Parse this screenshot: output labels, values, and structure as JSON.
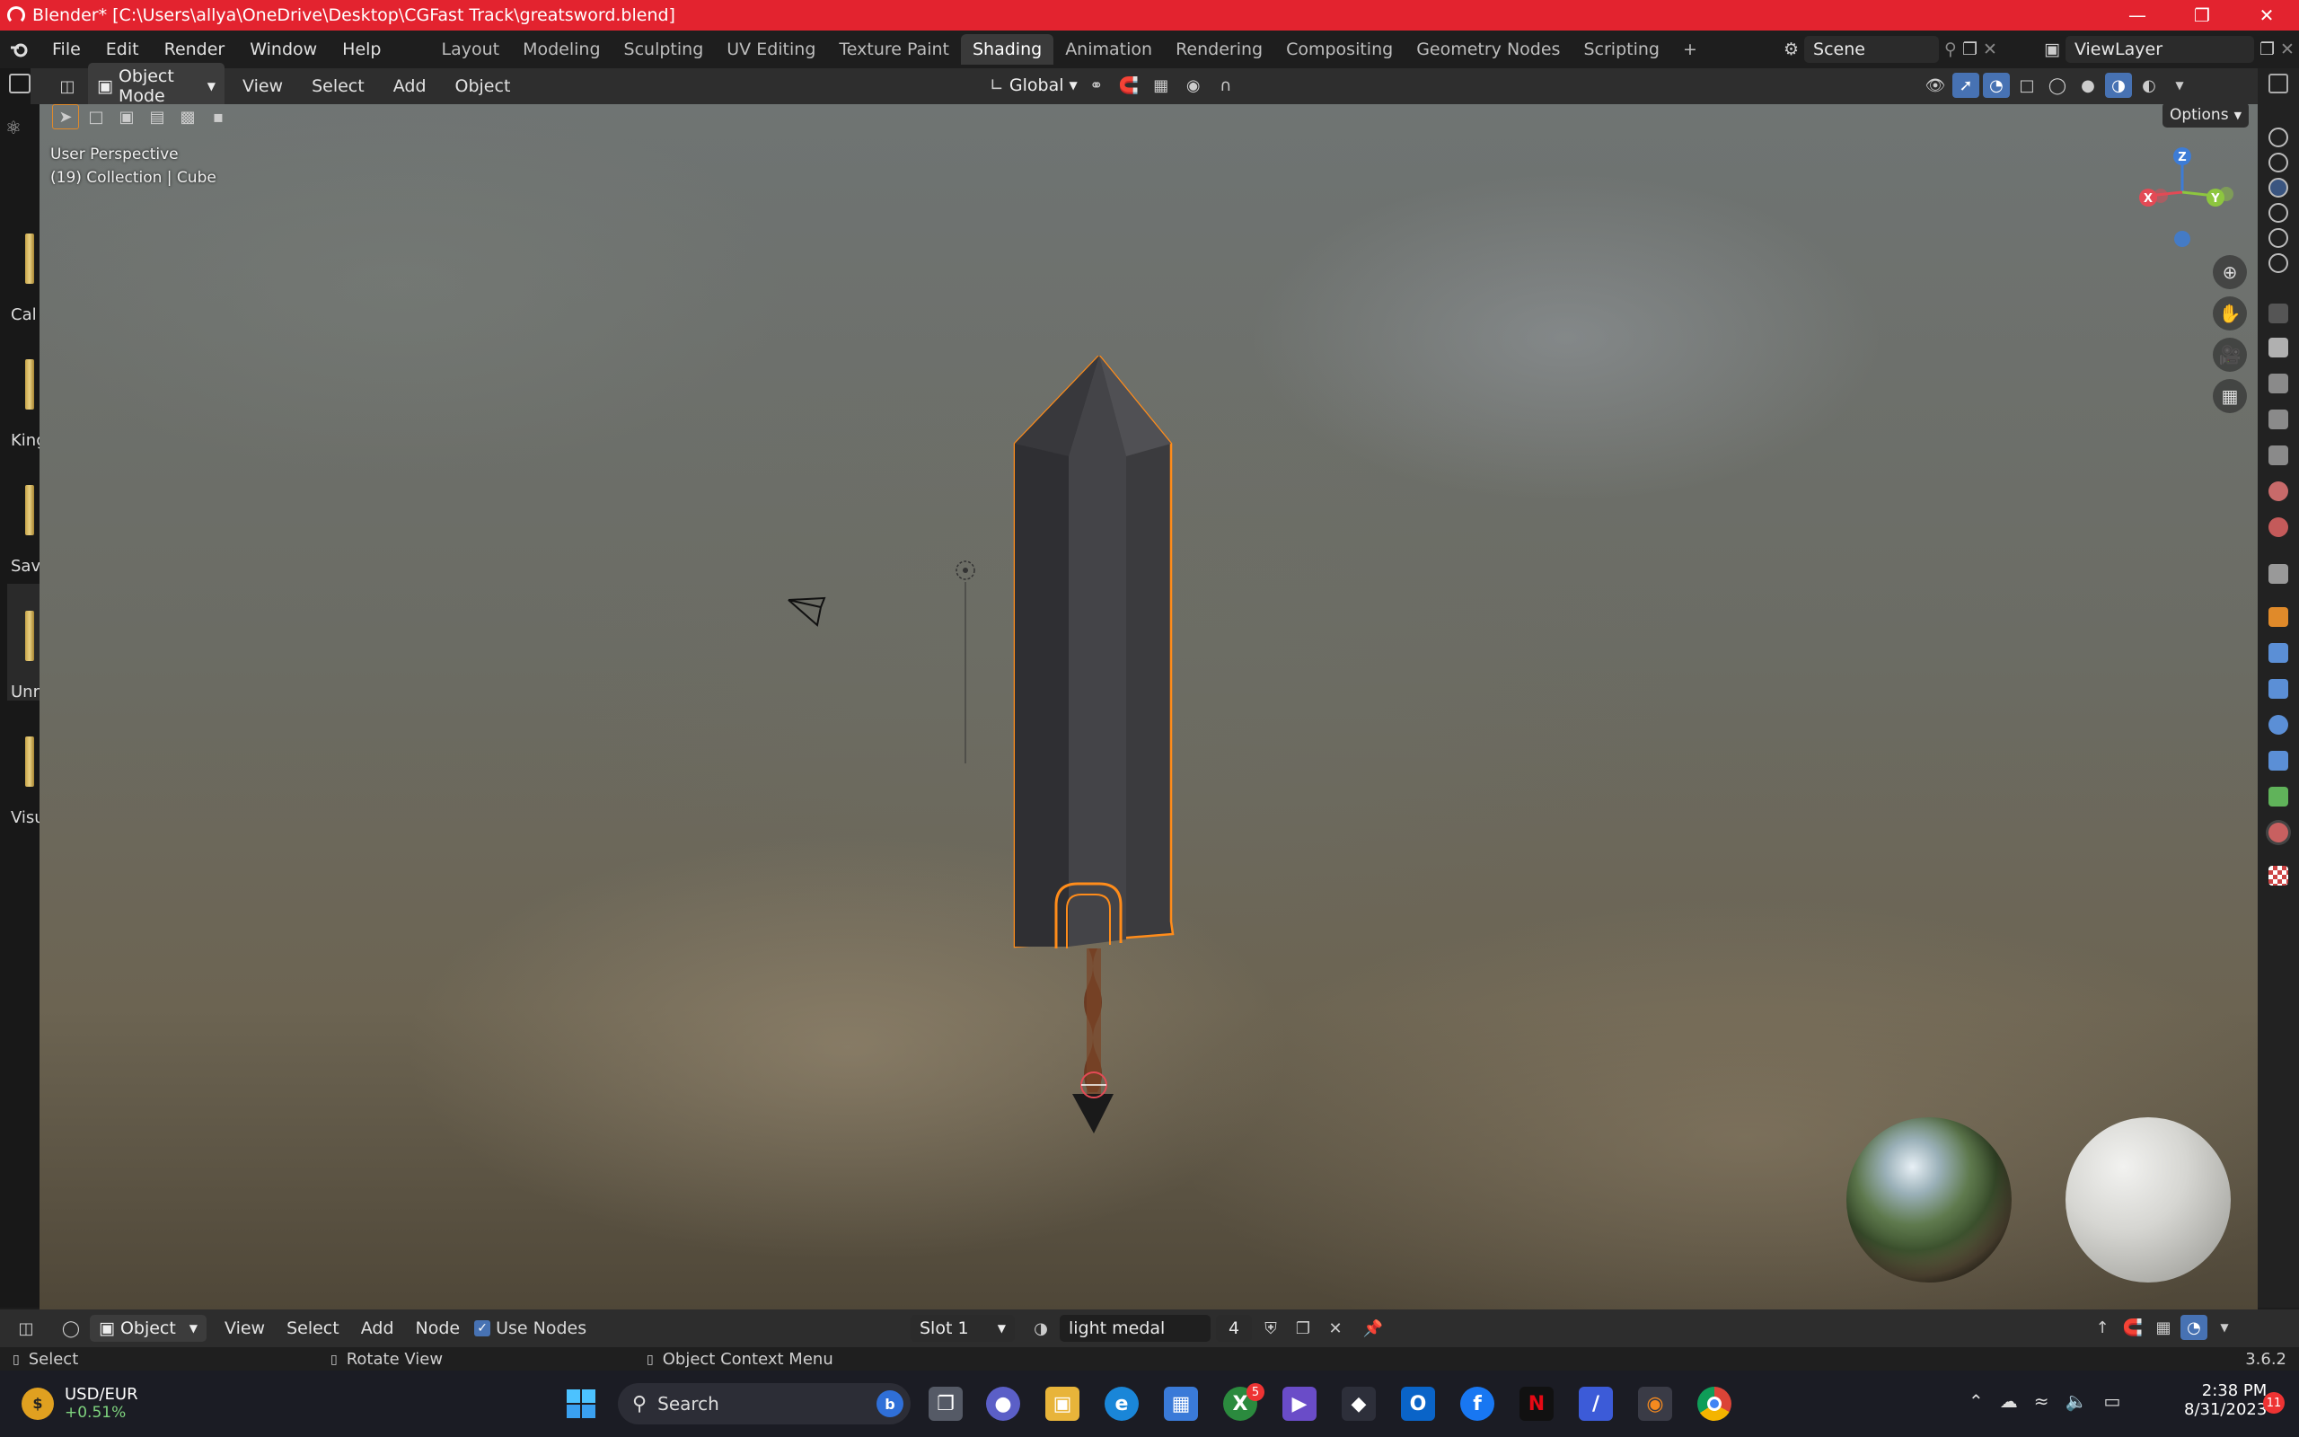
{
  "window": {
    "title": "Blender* [C:\\Users\\allya\\OneDrive\\Desktop\\CGFast Track\\greatsword.blend]"
  },
  "topbar": {
    "menus": [
      "File",
      "Edit",
      "Render",
      "Window",
      "Help"
    ],
    "workspaces": [
      "Layout",
      "Modeling",
      "Sculpting",
      "UV Editing",
      "Texture Paint",
      "Shading",
      "Animation",
      "Rendering",
      "Compositing",
      "Geometry Nodes",
      "Scripting"
    ],
    "active_workspace": "Shading",
    "add_tab": "+",
    "scene_value": "Scene",
    "viewlayer_value": "ViewLayer"
  },
  "viewport_header": {
    "mode": "Object Mode",
    "menus": [
      "View",
      "Select",
      "Add",
      "Object"
    ],
    "orientation": "Global",
    "options_label": "Options"
  },
  "viewport": {
    "perspective_label": "User Perspective",
    "collection_label": "(19) Collection | Cube",
    "gizmo": {
      "z": "Z",
      "y": "Y",
      "x": "X"
    }
  },
  "asset_list": [
    {
      "label": "Cal"
    },
    {
      "label": "King"
    },
    {
      "label": "Sav"
    },
    {
      "label": "Unr"
    },
    {
      "label": "Visu"
    }
  ],
  "shader_header": {
    "type": "Object",
    "menus": [
      "View",
      "Select",
      "Add",
      "Node"
    ],
    "use_nodes_label": "Use Nodes",
    "use_nodes_checked": true,
    "slot": "Slot 1",
    "material_name": "light medal",
    "user_count": "4"
  },
  "status_bar": {
    "select": "Select",
    "rotate": "Rotate View",
    "context": "Object Context Menu",
    "version": "3.6.2"
  },
  "taskbar": {
    "ticker_symbol": "USD/EUR",
    "ticker_change": "+0.51%",
    "search_placeholder": "Search",
    "time": "2:38 PM",
    "date": "8/31/2023",
    "notification_count": "11",
    "xbox_badge": "5"
  },
  "colors": {
    "title_red": "#e3232f",
    "accent_blue": "#4772b3",
    "selection_orange": "#ff8c1a",
    "axis_x": "#e34a55",
    "axis_y": "#8dc63f",
    "axis_z": "#3d7cd6"
  }
}
